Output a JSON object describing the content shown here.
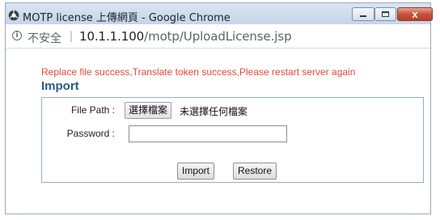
{
  "window": {
    "title": "MOTP license 上傳網頁 - Google Chrome",
    "close_label": "x"
  },
  "address": {
    "security_label": "不安全",
    "separator": "|",
    "host": "10.1.1.100",
    "path": "/motp/UploadLicense.jsp"
  },
  "page": {
    "message": "Replace file success,Translate token success,Please restart server again",
    "heading": "Import",
    "file_label": "File Path :",
    "choose_button": "選擇檔案",
    "no_file_text": "未選擇任何檔案",
    "password_label": "Password :",
    "password_value": "",
    "import_button": "Import",
    "restore_button": "Restore"
  },
  "colors": {
    "message": "#e04a3a",
    "heading": "#2a5a8a",
    "panel_border": "#8fb0cf"
  }
}
